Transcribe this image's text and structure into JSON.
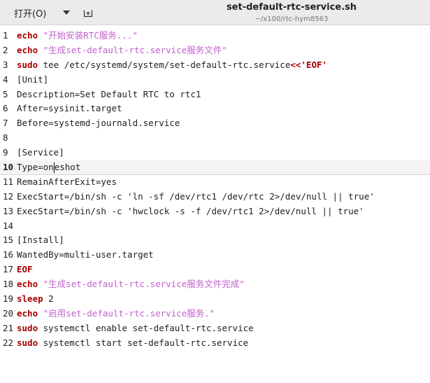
{
  "header": {
    "open_label": "打开(O)",
    "title": "set-default-rtc-service.sh",
    "path": "~/x100/rtc-hym8563",
    "open_caret_icon": "chevron-down-icon",
    "new_tab_icon": "new-tab-icon"
  },
  "colors": {
    "keyword": "#a40000",
    "string": "#c061cb",
    "header_bg": "#ebebeb",
    "current_line_bg": "#f4f4f4"
  },
  "editor": {
    "current_line": 10,
    "lines": [
      {
        "n": "1",
        "seg": [
          {
            "t": "echo",
            "c": "kw"
          },
          {
            "t": " ",
            "c": ""
          },
          {
            "t": "\"开始安装RTC服务...\"",
            "c": "str"
          }
        ]
      },
      {
        "n": "2",
        "seg": [
          {
            "t": "echo",
            "c": "kw"
          },
          {
            "t": " ",
            "c": ""
          },
          {
            "t": "\"生成set-default-rtc.service服务文件\"",
            "c": "str"
          }
        ]
      },
      {
        "n": "3",
        "seg": [
          {
            "t": "sudo",
            "c": "kw"
          },
          {
            "t": " tee /etc/systemd/system/set-default-rtc.service",
            "c": ""
          },
          {
            "t": "<<",
            "c": "redir"
          },
          {
            "t": "'EOF'",
            "c": "strb"
          }
        ]
      },
      {
        "n": "4",
        "seg": [
          {
            "t": "[Unit]",
            "c": ""
          }
        ]
      },
      {
        "n": "5",
        "seg": [
          {
            "t": "Description=Set Default RTC to rtc1",
            "c": ""
          }
        ]
      },
      {
        "n": "6",
        "seg": [
          {
            "t": "After=sysinit.target",
            "c": ""
          }
        ]
      },
      {
        "n": "7",
        "seg": [
          {
            "t": "Before=systemd-journald.service",
            "c": ""
          }
        ]
      },
      {
        "n": "8",
        "seg": []
      },
      {
        "n": "9",
        "seg": [
          {
            "t": "[Service]",
            "c": ""
          }
        ]
      },
      {
        "n": "10",
        "seg": [
          {
            "t": "Type=on",
            "c": ""
          },
          {
            "t": "",
            "c": "cursor"
          },
          {
            "t": "eshot",
            "c": ""
          }
        ]
      },
      {
        "n": "11",
        "seg": [
          {
            "t": "RemainAfterExit=yes",
            "c": ""
          }
        ]
      },
      {
        "n": "12",
        "seg": [
          {
            "t": "ExecStart=/bin/sh -c 'ln -sf /dev/rtc1 /dev/rtc 2>/dev/null || true'",
            "c": ""
          }
        ]
      },
      {
        "n": "13",
        "seg": [
          {
            "t": "ExecStart=/bin/sh -c 'hwclock -s -f /dev/rtc1 2>/dev/null || true'",
            "c": ""
          }
        ]
      },
      {
        "n": "14",
        "seg": []
      },
      {
        "n": "15",
        "seg": [
          {
            "t": "[Install]",
            "c": ""
          }
        ]
      },
      {
        "n": "16",
        "seg": [
          {
            "t": "WantedBy=multi-user.target",
            "c": ""
          }
        ]
      },
      {
        "n": "17",
        "seg": [
          {
            "t": "EOF",
            "c": "kw"
          }
        ]
      },
      {
        "n": "18",
        "seg": [
          {
            "t": "echo",
            "c": "kw"
          },
          {
            "t": " ",
            "c": ""
          },
          {
            "t": "\"生成set-default-rtc.service服务文件完成\"",
            "c": "str"
          }
        ]
      },
      {
        "n": "19",
        "seg": [
          {
            "t": "sleep",
            "c": "kw"
          },
          {
            "t": " 2",
            "c": ""
          }
        ]
      },
      {
        "n": "20",
        "seg": [
          {
            "t": "echo",
            "c": "kw"
          },
          {
            "t": " ",
            "c": ""
          },
          {
            "t": "\"启用set-default-rtc.service服务.\"",
            "c": "str"
          }
        ]
      },
      {
        "n": "21",
        "seg": [
          {
            "t": "sudo",
            "c": "kw"
          },
          {
            "t": " systemctl enable set-default-rtc.service",
            "c": ""
          }
        ]
      },
      {
        "n": "22",
        "seg": [
          {
            "t": "sudo",
            "c": "kw"
          },
          {
            "t": " systemctl start set-default-rtc.service",
            "c": ""
          }
        ]
      }
    ]
  }
}
